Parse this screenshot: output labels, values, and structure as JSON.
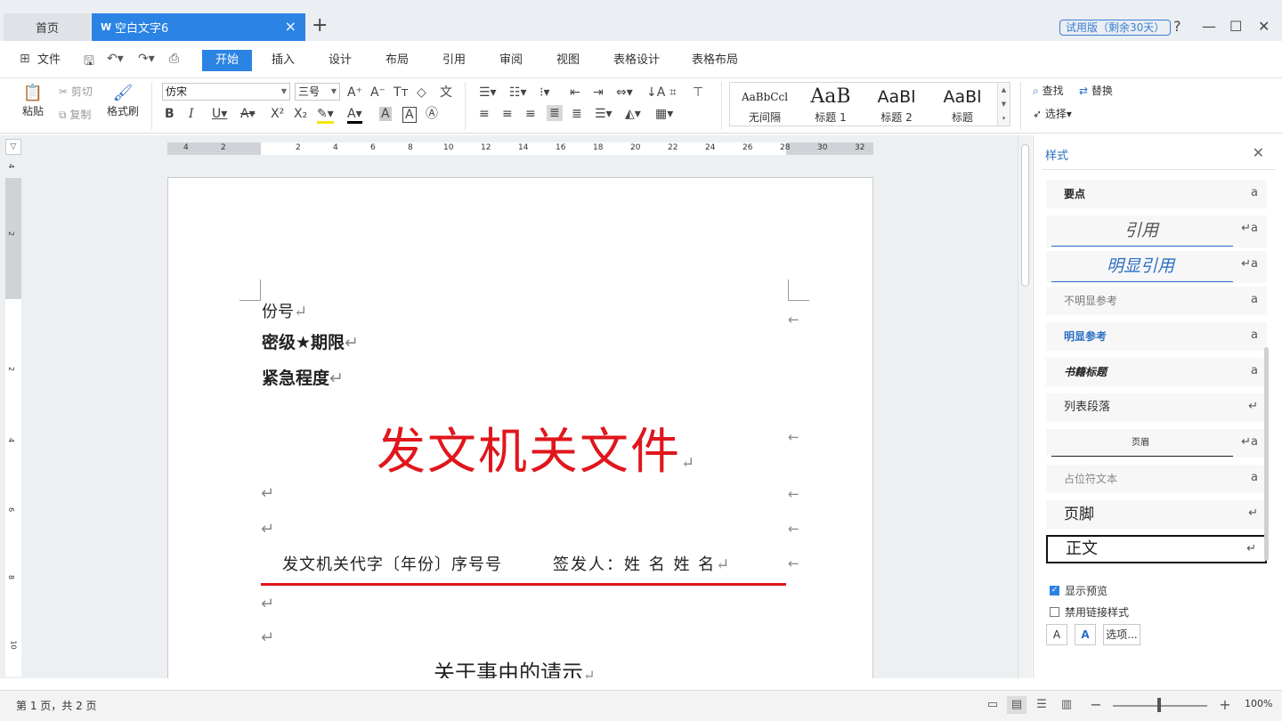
{
  "tabs": {
    "home": "首页",
    "doc": "空白文字6",
    "add": "+",
    "close": "×"
  },
  "titlebar": {
    "trial": "试用版（剩余30天）",
    "help": "?",
    "minimize": "—",
    "maximize": "☐",
    "close": "✕"
  },
  "menu": {
    "file": "文件",
    "items": [
      "开始",
      "插入",
      "设计",
      "布局",
      "引用",
      "审阅",
      "视图",
      "表格设计",
      "表格布局"
    ]
  },
  "ribbon": {
    "paste": "粘贴",
    "cut": "剪切",
    "copy": "复制",
    "format_painter": "格式刷",
    "font_name": "仿宋",
    "font_size": "三号",
    "find": "查找",
    "replace": "替换",
    "select": "选择",
    "styles": [
      {
        "sample": "AaBbCcl",
        "label": "无间隔"
      },
      {
        "sample": "AaB",
        "label": "标题 1"
      },
      {
        "sample": "AaBl",
        "label": "标题 2"
      },
      {
        "sample": "AaBl",
        "label": "标题"
      }
    ]
  },
  "document": {
    "line1": "份号",
    "line2": "密级★期限",
    "line3": "紧急程度",
    "title": "发文机关文件",
    "doc_number": "发文机关代字〔年份〕序号号",
    "signer": "签发人：姓  名  姓  名",
    "subject": "关于事由的请示",
    "para_mark": "↵"
  },
  "style_panel": {
    "title": "样式",
    "items": [
      {
        "name": "要点",
        "mark": "a"
      },
      {
        "name": "引用",
        "mark": "↵a"
      },
      {
        "name": "明显引用",
        "mark": "↵a"
      },
      {
        "name": "不明显参考",
        "mark": "a"
      },
      {
        "name": "明显参考",
        "mark": "a"
      },
      {
        "name": "书籍标题",
        "mark": "a"
      },
      {
        "name": "列表段落",
        "mark": "↵"
      },
      {
        "name": "页眉",
        "mark": "↵a"
      },
      {
        "name": "占位符文本",
        "mark": "a"
      },
      {
        "name": "页脚",
        "mark": "↵"
      },
      {
        "name": "正文",
        "mark": "↵"
      }
    ],
    "show_preview": "显示预览",
    "disable_linked": "禁用链接样式",
    "options": "选项..."
  },
  "statusbar": {
    "pages": "第 1 页，共 2 页",
    "zoom": "100%"
  },
  "ruler": {
    "h_ticks": [
      "4",
      "2",
      "2",
      "4",
      "6",
      "8",
      "10",
      "12",
      "14",
      "16",
      "18",
      "20",
      "22",
      "24",
      "26",
      "28",
      "30",
      "32"
    ],
    "v_ticks": [
      "4",
      "2",
      "2",
      "4",
      "6",
      "8",
      "10"
    ]
  }
}
